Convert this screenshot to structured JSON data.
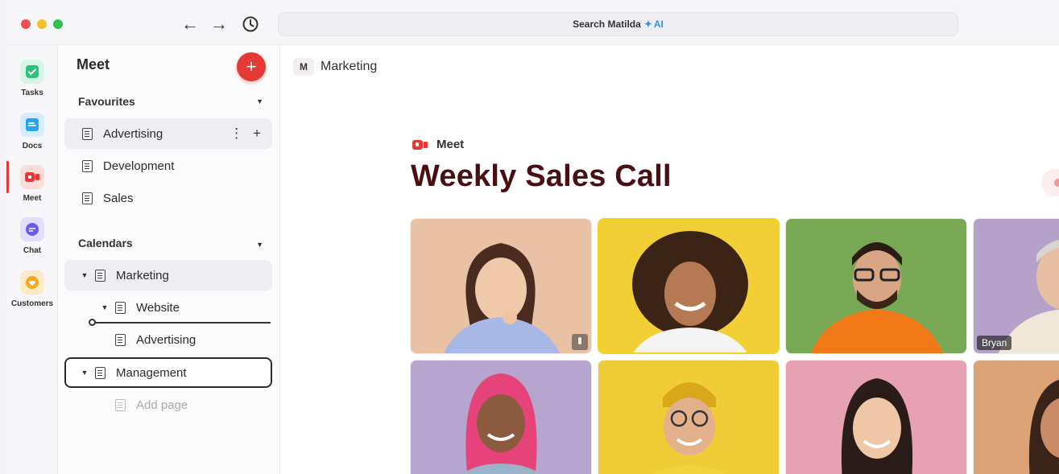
{
  "search": {
    "label": "Search Matilda",
    "ai_label": "AI",
    "spark_icon": "✦"
  },
  "nav": {
    "back_icon": "←",
    "forward_icon": "→",
    "history_icon": "🕓"
  },
  "window_dots": [
    "#ef4f4f",
    "#f5bf2a",
    "#2fc24e"
  ],
  "rail": [
    {
      "label": "Tasks",
      "icon": "check-icon",
      "color": "#2bc27c"
    },
    {
      "label": "Docs",
      "icon": "doc-icon",
      "color": "#2aa3ee"
    },
    {
      "label": "Meet",
      "icon": "video-icon",
      "color": "#e53935"
    },
    {
      "label": "Chat",
      "icon": "chat-icon",
      "color": "#6b5ce7"
    },
    {
      "label": "Customers",
      "icon": "heart-icon",
      "color": "#f5a623"
    }
  ],
  "sidebar": {
    "title": "Meet",
    "add_label": "+",
    "favourites_label": "Favourites",
    "favourites": [
      "Advertising",
      "Development",
      "Sales"
    ],
    "calendars_label": "Calendars",
    "calendars": [
      {
        "label": "Marketing"
      },
      {
        "label": "Website"
      },
      {
        "label": "Advertising"
      },
      {
        "label": "Management"
      },
      {
        "label": "Add page"
      }
    ],
    "row_more": "⋮",
    "row_add": "+"
  },
  "breadcrumb": {
    "badge": "M",
    "label": "Marketing"
  },
  "meeting": {
    "tag": "Meet",
    "title": "Weekly Sales Call"
  },
  "participants": [
    {
      "name": "",
      "bg": "#e9c2a6",
      "muted": true
    },
    {
      "name": "",
      "bg": "#f2cf34",
      "muted": false
    },
    {
      "name": "",
      "bg": "#78a854",
      "muted": false
    },
    {
      "name": "Bryan",
      "bg": "#b6a1c9",
      "muted": false
    },
    {
      "name": "",
      "bg": "#b6a5cf",
      "muted": false
    },
    {
      "name": "",
      "bg": "#f0cc37",
      "muted": false
    },
    {
      "name": "",
      "bg": "#e6a2b4",
      "muted": false
    },
    {
      "name": "",
      "bg": "#dca377",
      "muted": false
    }
  ]
}
